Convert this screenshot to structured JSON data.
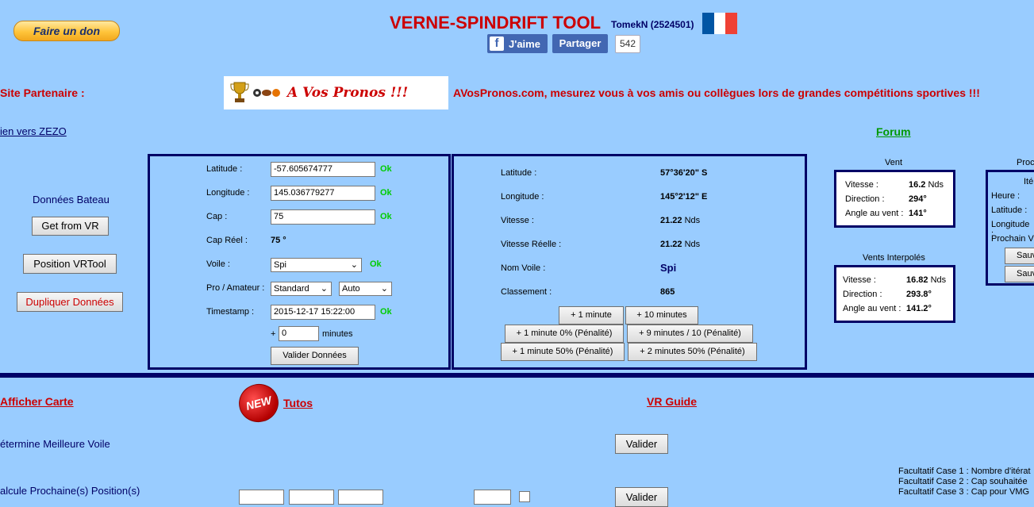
{
  "header": {
    "donate_label": "Faire un don",
    "title": "VERNE-SPINDRIFT TOOL",
    "user": "TomekN (2524501)",
    "fb_like": "J'aime",
    "fb_share": "Partager",
    "fb_count": "542",
    "flag_colors": [
      "#0055a4",
      "#ffffff",
      "#ef4135"
    ]
  },
  "partner": {
    "label": "Site Partenaire :",
    "banner_text": "A Vos Pronos !!!",
    "text": "AVosPronos.com, mesurez vous à vos amis ou collègues lors de grandes compétitions sportives !!!"
  },
  "links": {
    "zezo": "ien vers ZEZO",
    "forum": "Forum"
  },
  "boat": {
    "label": "Données Bateau",
    "get_vr": "Get from VR",
    "position_vrtool": "Position VRTool",
    "duplicate": "Dupliquer Données"
  },
  "form": {
    "lat_label": "Latitude :",
    "lat_value": "-57.605674777",
    "lon_label": "Longitude :",
    "lon_value": "145.036779277",
    "cap_label": "Cap :",
    "cap_value": "75",
    "cap_reel_label": "Cap Réel :",
    "cap_reel_value": "75 °",
    "voile_label": "Voile :",
    "voile_value": "Spi",
    "pro_label": "Pro / Amateur :",
    "pro_value": "Standard",
    "mode_value": "Auto",
    "ts_label": "Timestamp :",
    "ts_value": "2015-12-17 15:22:00",
    "plus": "+",
    "minutes_value": "0",
    "minutes_label": "minutes",
    "validate": "Valider Données",
    "ok": "Ok"
  },
  "results": {
    "lat_label": "Latitude :",
    "lat_value": "57°36'20\" S",
    "lon_label": "Longitude :",
    "lon_value": "145°2'12\" E",
    "speed_label": "Vitesse :",
    "speed_value": "21.22",
    "speed_unit": "Nds",
    "real_speed_label": "Vitesse Réelle :",
    "real_speed_value": "21.22",
    "real_speed_unit": "Nds",
    "sail_label": "Nom Voile :",
    "sail_value": "Spi",
    "rank_label": "Classement :",
    "rank_value": "865",
    "btn_1min": "+ 1 minute",
    "btn_10min": "+ 10 minutes",
    "btn_1min_0": "+ 1 minute 0% (Pénalité)",
    "btn_9min": "+ 9 minutes / 10 (Pénalité)",
    "btn_1min_50": "+ 1 minute 50% (Pénalité)",
    "btn_2min_50": "+ 2 minutes 50% (Pénalité)"
  },
  "wind": {
    "title": "Vent",
    "speed_label": "Vitesse :",
    "speed_value": "16.2",
    "speed_unit": "Nds",
    "dir_label": "Direction :",
    "dir_value": "294°",
    "angle_label": "Angle au vent :",
    "angle_value": "141°"
  },
  "wind_interp": {
    "title": "Vents Interpolés",
    "speed_label": "Vitesse :",
    "speed_value": "16.82",
    "speed_unit": "Nds",
    "dir_label": "Direction :",
    "dir_value": "293.8°",
    "angle_label": "Angle au vent :",
    "angle_value": "141.2°"
  },
  "next": {
    "title": "Proc",
    "iter": "Itér",
    "heure": "Heure :",
    "latitude": "Latitude :",
    "longitude": "Longitude :",
    "prochain": "Prochain V",
    "sauv1": "Sauv",
    "sauv2": "Sauv"
  },
  "bottom": {
    "afficher_carte": "Afficher Carte",
    "new_badge": "NEW",
    "tutos": "Tutos",
    "vr_guide": "VR Guide",
    "best_sail": "étermine Meilleure Voile",
    "valider": "Valider",
    "calc_next": "alcule Prochaine(s) Position(s)",
    "valider2": "Valider",
    "fac1": "Facultatif Case 1 : Nombre d'itérat",
    "fac2": "Facultatif Case 2 : Cap souhaitée",
    "fac3": "Facultatif Case 3 : Cap pour VMG"
  }
}
